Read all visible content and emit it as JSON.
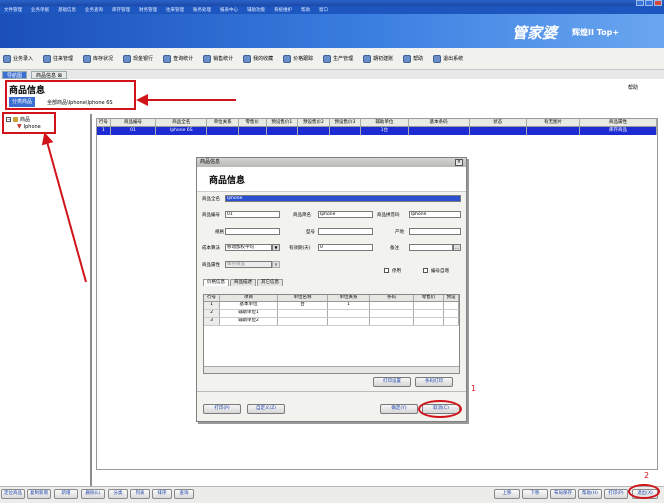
{
  "window": {
    "title": "管家婆辉煌II Top+"
  },
  "menubar": [
    "文件管理",
    "业务单据",
    "基础信息",
    "业务查询",
    "库存管理",
    "财务管理",
    "往来管理",
    "账务处理",
    "报表中心",
    "辅助功能",
    "系统维护",
    "帮助",
    "窗口"
  ],
  "banner": {
    "logo": "管家婆",
    "edition": "辉煌II Top+"
  },
  "toolbar": [
    {
      "label": "业务录入",
      "icon": "entry-icon"
    },
    {
      "label": "往来管理",
      "icon": "chart-icon"
    },
    {
      "label": "库存状况",
      "icon": "stock-icon"
    },
    {
      "label": "现金银行",
      "icon": "cash-icon"
    },
    {
      "label": "查询统计",
      "icon": "query-icon"
    },
    {
      "label": "销售统计",
      "icon": "sales-icon"
    },
    {
      "label": "我的收藏",
      "icon": "star-icon"
    },
    {
      "label": "价格跟踪",
      "icon": "price-icon"
    },
    {
      "label": "生产管理",
      "icon": "tools-icon"
    },
    {
      "label": "期初建账",
      "icon": "setup-icon"
    },
    {
      "label": "帮助",
      "icon": "help-icon"
    },
    {
      "label": "退出系统",
      "icon": "exit-icon"
    }
  ],
  "tabs": [
    {
      "label": "导航图"
    },
    {
      "label": "商品信息 ⊠"
    }
  ],
  "header": {
    "title": "商品信息",
    "category_button": "分类商品",
    "path": "全部商品\\Iphone\\Iphone 6S",
    "help": "帮助"
  },
  "tree": {
    "root": "商品",
    "child": "Iphone"
  },
  "grid": {
    "columns": [
      "行号",
      "商品编号",
      "商品全名",
      "单位关系",
      "零售价",
      "预设售价1",
      "预设售价2",
      "预设售价3",
      "辅助单位",
      "基本条码",
      "状态",
      "有无图片",
      "商品属性"
    ],
    "row": [
      "1",
      "01",
      "Iphone 6S",
      "",
      "",
      "",
      "",
      "",
      "1台",
      "",
      "",
      "",
      "库存商品"
    ]
  },
  "dialog": {
    "title": "商品信息",
    "heading": "商品信息",
    "fields": {
      "fullname_label": "商品全名",
      "fullname": "Iphone",
      "code_label": "商品编号",
      "code": "01",
      "short_label": "商品简名",
      "short": "Iphone",
      "pinyin_label": "商品拼音码",
      "pinyin": "Iphone",
      "spec_label": "规格",
      "spec": "",
      "model_label": "型号",
      "model": "",
      "origin_label": "产地",
      "origin": "",
      "cost_label": "成本算法",
      "cost": "移动加权平均",
      "valid_label": "有效期(天)",
      "valid": "0",
      "memo_label": "备注",
      "memo": "",
      "attr_label": "商品属性",
      "attr": "库存商品",
      "disable_label": "停用",
      "autocode_label": "编号自增"
    },
    "tabs": [
      "价格信息",
      "商品描述",
      "其它信息"
    ],
    "unit_grid": {
      "columns": [
        "行号",
        "项目",
        "单位名称",
        "单位关系",
        "条码",
        "零售价",
        "预设"
      ],
      "rows": [
        [
          "1",
          "基本单位",
          "台",
          "1",
          "",
          "",
          ""
        ],
        [
          "2",
          "辅助单位1",
          "",
          "",
          "",
          "",
          ""
        ],
        [
          "3",
          "辅助单位2",
          "",
          "",
          "",
          "",
          ""
        ]
      ]
    },
    "buttons": {
      "print_setup": "打印设置",
      "barcode_print": "条码打印",
      "print": "打印(P)",
      "custom": "自定义(Z)",
      "ok": "确定(Y)",
      "cancel": "取消(C)"
    }
  },
  "annotations": {
    "step1": "1",
    "step2": "2"
  },
  "bottombar": {
    "left": [
      "定位商品",
      "复制新增",
      "新增",
      "删除(L)",
      "分类",
      "列表",
      "排序",
      "查询"
    ],
    "right": [
      "上移",
      "下移",
      "布局保存",
      "帮助(H)",
      "打印(P)",
      "退出(X)"
    ]
  },
  "colors": {
    "highlight": "#d0141a",
    "selection": "#1c2cd2",
    "banner": "#1a4fb8"
  }
}
